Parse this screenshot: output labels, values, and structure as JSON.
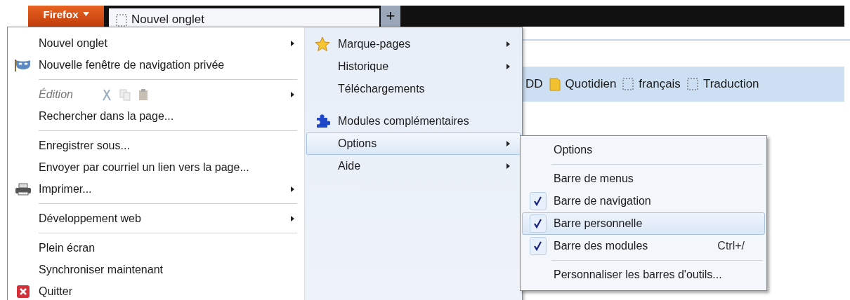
{
  "firefox_button": {
    "label": "Firefox"
  },
  "tab": {
    "title": "Nouvel onglet"
  },
  "new_tab_button": {
    "label": "+"
  },
  "bookmarks_bar": {
    "items": [
      {
        "label": "DD",
        "kind": "text"
      },
      {
        "label": "Quotidien",
        "kind": "folder"
      },
      {
        "label": "français",
        "kind": "page"
      },
      {
        "label": "Traduction",
        "kind": "page"
      }
    ]
  },
  "main_menu": {
    "left_items": [
      {
        "kind": "item",
        "label": "Nouvel onglet",
        "submenu": true,
        "disabled": false
      },
      {
        "kind": "private",
        "label": "Nouvelle fenêtre de navigation privée",
        "submenu": false,
        "disabled": false
      },
      {
        "kind": "separator"
      },
      {
        "kind": "edit",
        "label": "Édition",
        "submenu": true,
        "disabled": true
      },
      {
        "kind": "item",
        "label": "Rechercher dans la page...",
        "submenu": false,
        "disabled": false
      },
      {
        "kind": "separator"
      },
      {
        "kind": "item",
        "label": "Enregistrer sous...",
        "submenu": false,
        "disabled": false
      },
      {
        "kind": "item",
        "label": "Envoyer par courriel un lien vers la page...",
        "submenu": false,
        "disabled": false
      },
      {
        "kind": "print",
        "label": "Imprimer...",
        "submenu": true,
        "disabled": false
      },
      {
        "kind": "separator"
      },
      {
        "kind": "item",
        "label": "Développement web",
        "submenu": true,
        "disabled": false
      },
      {
        "kind": "separator"
      },
      {
        "kind": "item",
        "label": "Plein écran",
        "submenu": false,
        "disabled": false
      },
      {
        "kind": "item",
        "label": "Synchroniser maintenant",
        "submenu": false,
        "disabled": false
      },
      {
        "kind": "quit",
        "label": "Quitter",
        "submenu": false,
        "disabled": false
      }
    ],
    "right_items": [
      {
        "kind": "bookmarks",
        "label": "Marque-pages",
        "submenu": true,
        "selected": false
      },
      {
        "kind": "item",
        "label": "Historique",
        "submenu": true,
        "selected": false
      },
      {
        "kind": "item",
        "label": "Téléchargements",
        "submenu": false,
        "selected": false
      },
      {
        "kind": "gap"
      },
      {
        "kind": "addons",
        "label": "Modules complémentaires",
        "submenu": false,
        "selected": false
      },
      {
        "kind": "item",
        "label": "Options",
        "submenu": true,
        "selected": true
      },
      {
        "kind": "item",
        "label": "Aide",
        "submenu": true,
        "selected": false
      }
    ]
  },
  "options_submenu": {
    "items": [
      {
        "kind": "item",
        "label": "Options",
        "checked": false,
        "selected": false
      },
      {
        "kind": "separator"
      },
      {
        "kind": "item",
        "label": "Barre de menus",
        "checked": false,
        "selected": false
      },
      {
        "kind": "item",
        "label": "Barre de navigation",
        "checked": true,
        "selected": false
      },
      {
        "kind": "item",
        "label": "Barre personnelle",
        "checked": true,
        "selected": true
      },
      {
        "kind": "item",
        "label": "Barre des modules",
        "checked": true,
        "selected": false,
        "shortcut": "Ctrl+/"
      },
      {
        "kind": "separator"
      },
      {
        "kind": "item",
        "label": "Personnaliser les barres d'outils...",
        "checked": false,
        "selected": false
      }
    ]
  }
}
